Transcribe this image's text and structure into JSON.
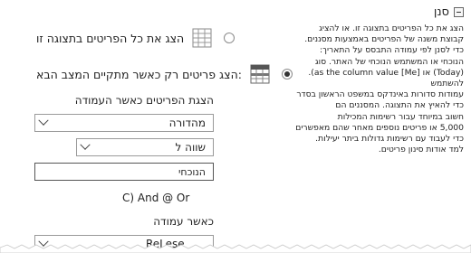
{
  "info_panel": {
    "title": "סנן",
    "lines": [
      "הצג את כל הפריטים בתצוגה זו. או להציג",
      "קבוצת משנה של הפריטים באמצעות מסננים.",
      "כדי לסנן לפי עמודה התבסס על התאריך:",
      "הנוכחי או המשתמש הנוכחי של האתר. סוג",
      "(Today) או [Me] as the column value). להשתמש",
      "עמודות סדורות באינדקס במשפט הראשון בסדר",
      "כדי להאיץ את התצוגה. המסננים הם",
      "חשוב במיוחד עבור רשימות המכילות",
      "5,000 או פריטים נוספים מאחר שהם מאפשרים",
      "כדי לעבוד עם רשימות גדולות ביתר יעילות.",
      "למד אודות סינון פריטים."
    ]
  },
  "options": {
    "show_all_label": "הצג את כל הפריטים בתצוגה זו",
    "show_filtered_label": "הצג פריטים רק כאשר מתקיים המצב הבא:",
    "selected": "show_filtered"
  },
  "filter": {
    "show_items_when_label": "הצגת הפריטים כאשר העמודה",
    "column_value": "מהדורה",
    "operator_value": "שווה ל",
    "value_input": "הנוכחי",
    "and_or_label": "C) And @ Or",
    "when_column_label": "כאשר עמודה",
    "next_column_value": "ReLese"
  }
}
